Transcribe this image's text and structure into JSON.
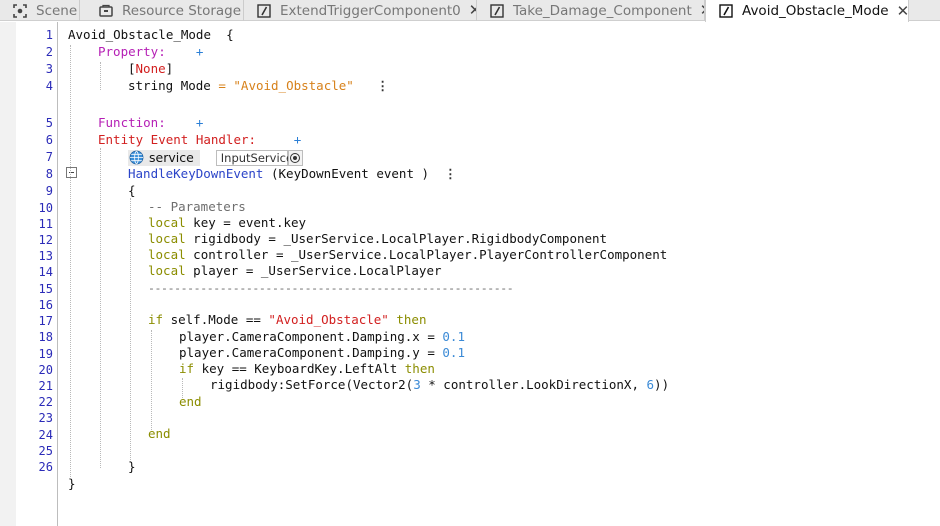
{
  "tabs": [
    {
      "label": "Scene",
      "icon": "scene-icon",
      "active": false,
      "closable": false
    },
    {
      "label": "Resource Storage",
      "icon": "storage-icon",
      "active": false,
      "closable": false
    },
    {
      "label": "ExtendTriggerComponent0",
      "icon": "script-icon",
      "active": false,
      "closable": true
    },
    {
      "label": "Take_Damage_Component",
      "icon": "script-icon",
      "active": false,
      "closable": true
    },
    {
      "label": "Avoid_Obstacle_Mode",
      "icon": "script-icon",
      "active": true,
      "closable": true
    }
  ],
  "close_glyph": "✕",
  "line_numbers": [
    "1",
    "2",
    "3",
    "4",
    "5",
    "6",
    "7",
    "8",
    "9",
    "10",
    "11",
    "12",
    "13",
    "14",
    "15",
    "16",
    "17",
    "18",
    "19",
    "20",
    "21",
    "22",
    "23",
    "24",
    "25",
    "26"
  ],
  "editor": {
    "component_name": "Avoid_Obstacle_Mode",
    "open_brace": "{",
    "close_brace": "}",
    "property_label": "Property:",
    "add_glyph": "+",
    "more_glyph": "⋮",
    "property": {
      "attr_open": "[",
      "attr": "None",
      "attr_close": "]",
      "type": "string",
      "name": "Mode",
      "equals": "=",
      "value": "\"Avoid_Obstacle\""
    },
    "function_label": "Function:",
    "handler_label": "Entity Event Handler:",
    "service": {
      "name": "service",
      "value": "InputService"
    },
    "handler": {
      "name": "HandleKeyDownEvent",
      "params": "(KeyDownEvent event )"
    },
    "body": {
      "open": "{",
      "comment": "-- Parameters",
      "local_kw": "local",
      "l11": " key = event.key",
      "l12": " rigidbody = _UserService.LocalPlayer.RigidbodyComponent",
      "l13": " controller = _UserService.LocalPlayer.PlayerControllerComponent",
      "l14": " player = _UserService.LocalPlayer",
      "separator": "--------------------------------------------------------",
      "if_kw": "if",
      "then_kw": "then",
      "end_kw": "end",
      "l17_mid": " self.Mode == ",
      "l17_str": "\"Avoid_Obstacle\"",
      "l18_text": "player.CameraComponent.Damping.x = ",
      "l18_num": "0.1",
      "l19_text": "player.CameraComponent.Damping.y = ",
      "l19_num": "0.1",
      "l20_mid": " key == KeyboardKey.LeftAlt ",
      "l21_a": "rigidbody:SetForce(Vector2(",
      "l21_n1": "3",
      "l21_b": " * controller.LookDirectionX, ",
      "l21_n2": "6",
      "l21_c": "))",
      "close": "}"
    }
  },
  "colors": {
    "keyword_purple": "#b51fb5",
    "keyword_red": "#d21f1f",
    "keyword_blue": "#2b44c8",
    "keyword_olive": "#8b8d00",
    "string": "#d7811a",
    "number": "#3b8ad6",
    "line_number": "#2b2bb8"
  }
}
